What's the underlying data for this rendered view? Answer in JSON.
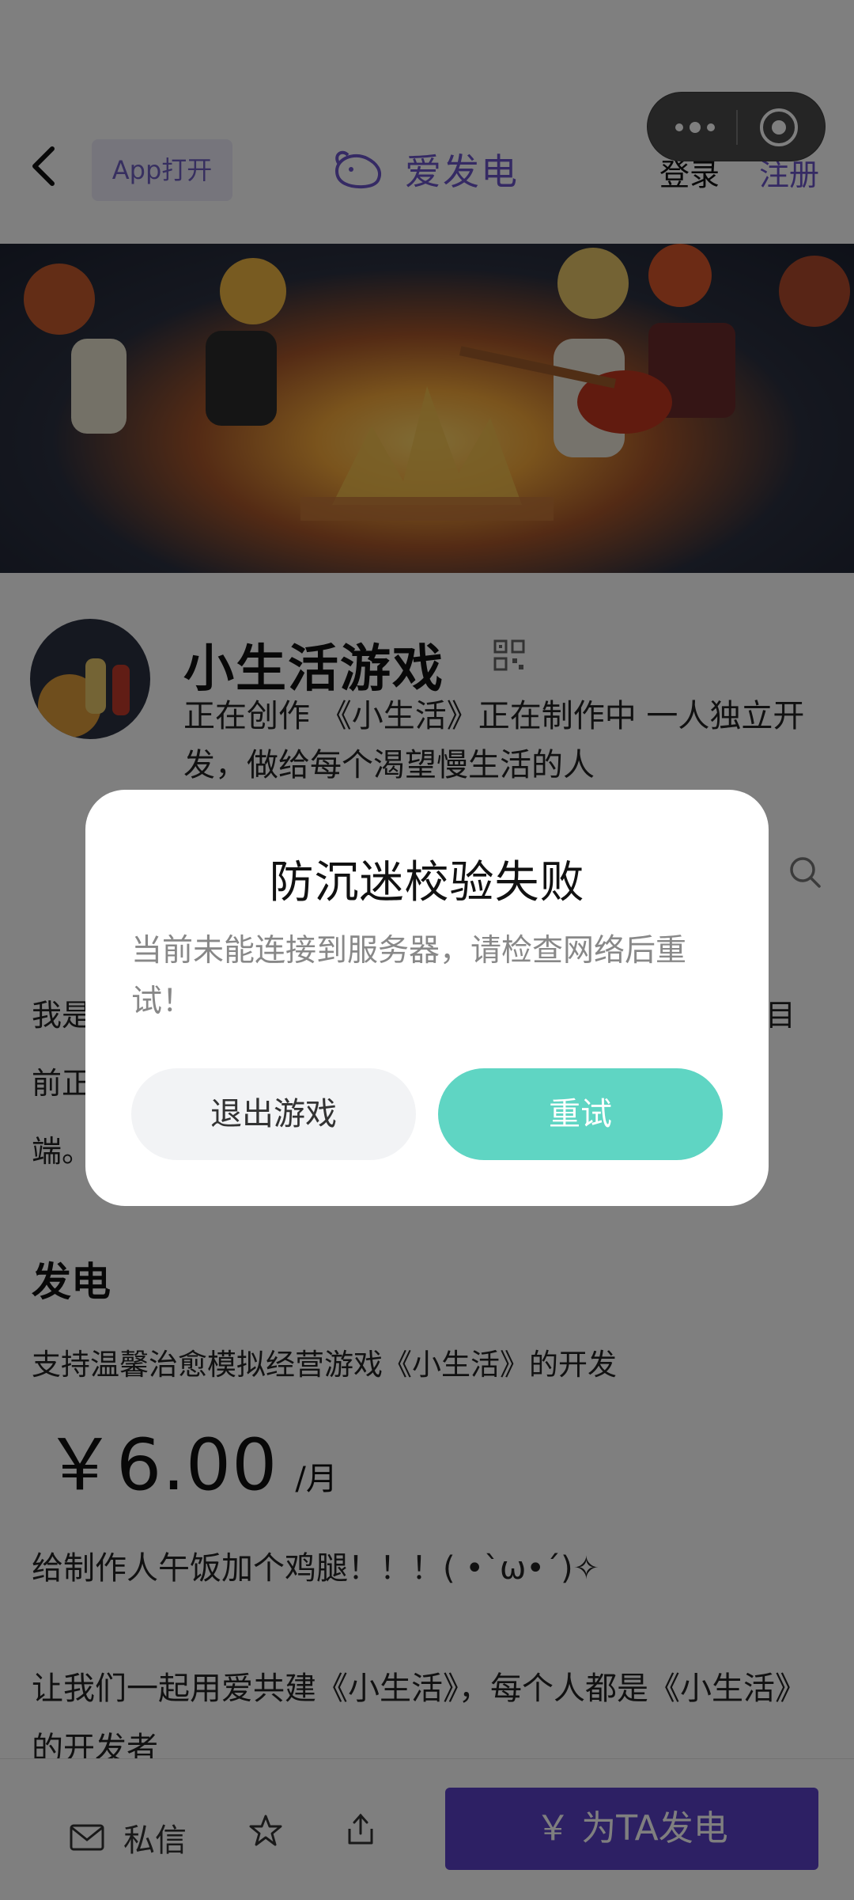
{
  "topbar": {
    "app_open_label": "App打开",
    "brand_name": "爱发电",
    "login_label": "登录",
    "register_label": "注册"
  },
  "profile": {
    "name": "小生活游戏",
    "description": "正在创作 《小生活》正在制作中 一人独立开发，做给每个渴望慢生活的人"
  },
  "intro": {
    "text_fragments": [
      "我是",
      "目",
      "前正",
      "端。",
      "!"
    ]
  },
  "donate": {
    "title": "发电",
    "subtitle": "支持温馨治愈模拟经营游戏《小生活》的开发",
    "price": "￥6.00",
    "unit": "/月",
    "body": "给制作人午饭加个鸡腿！！！( •`ω•´)✧\n\n让我们一起用爱共建《小生活》，每个人都是《小生活》的开发者"
  },
  "bottombar": {
    "message_label": "私信",
    "charge_label": "￥ 为TA发电"
  },
  "dialog": {
    "title": "防沉迷校验失败",
    "message": "当前未能连接到服务器，请检查网络后重试！",
    "exit_label": "退出游戏",
    "retry_label": "重试"
  },
  "colors": {
    "brand_purple": "#6a55c8",
    "charge_button": "#5b40c8",
    "retry_button": "#5fd5c3",
    "overlay": "rgba(0,0,0,0.5)"
  },
  "icons": [
    "back-arrow-icon",
    "brand-logo-icon",
    "more-dots-icon",
    "close-target-icon",
    "qr-code-icon",
    "search-icon",
    "mail-icon",
    "star-icon",
    "share-icon"
  ]
}
